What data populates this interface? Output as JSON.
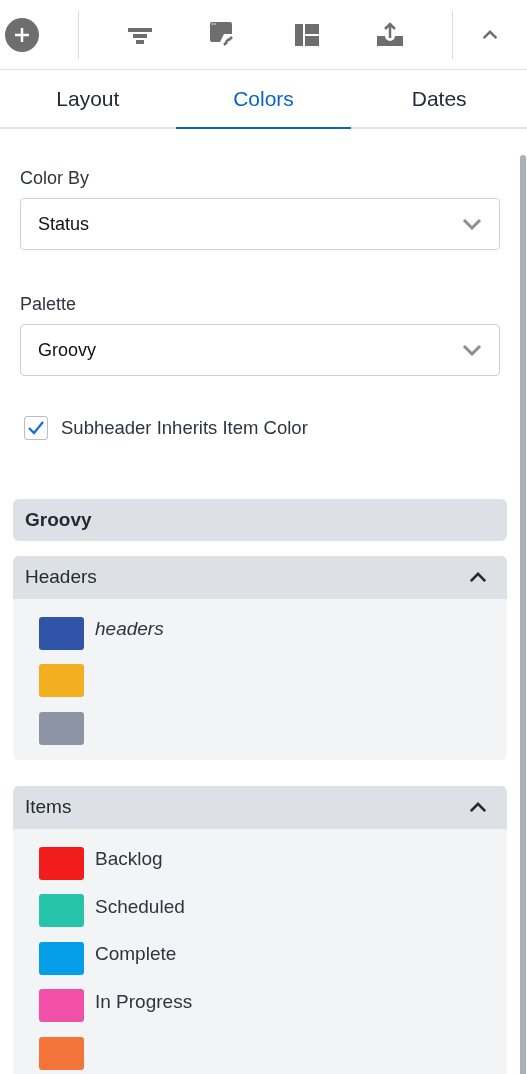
{
  "tabs": [
    {
      "label": "Layout",
      "selected": false
    },
    {
      "label": "Colors",
      "selected": true
    },
    {
      "label": "Dates",
      "selected": false
    }
  ],
  "color_by": {
    "label": "Color By",
    "value": "Status"
  },
  "palette": {
    "label": "Palette",
    "value": "Groovy"
  },
  "subheader_inherits": {
    "label": "Subheader Inherits Item Color",
    "checked": true
  },
  "palette_name": "Groovy",
  "sections": [
    {
      "title": "Headers",
      "expanded": true,
      "swatches": [
        {
          "color": "#3055a8",
          "label": "headers",
          "italic": true
        },
        {
          "color": "#f2b020"
        },
        {
          "color": "#8d94a3"
        }
      ]
    },
    {
      "title": "Items",
      "expanded": true,
      "swatches": [
        {
          "color": "#f21c1c",
          "label": "Backlog",
          "italic": false
        },
        {
          "color": "#26c4a8",
          "label": "Scheduled",
          "italic": false
        },
        {
          "color": "#049ee8",
          "label": "Complete",
          "italic": false
        },
        {
          "color": "#f24fa8",
          "label": "In Progress",
          "italic": false
        },
        {
          "color": "#f5743a"
        }
      ]
    }
  ]
}
